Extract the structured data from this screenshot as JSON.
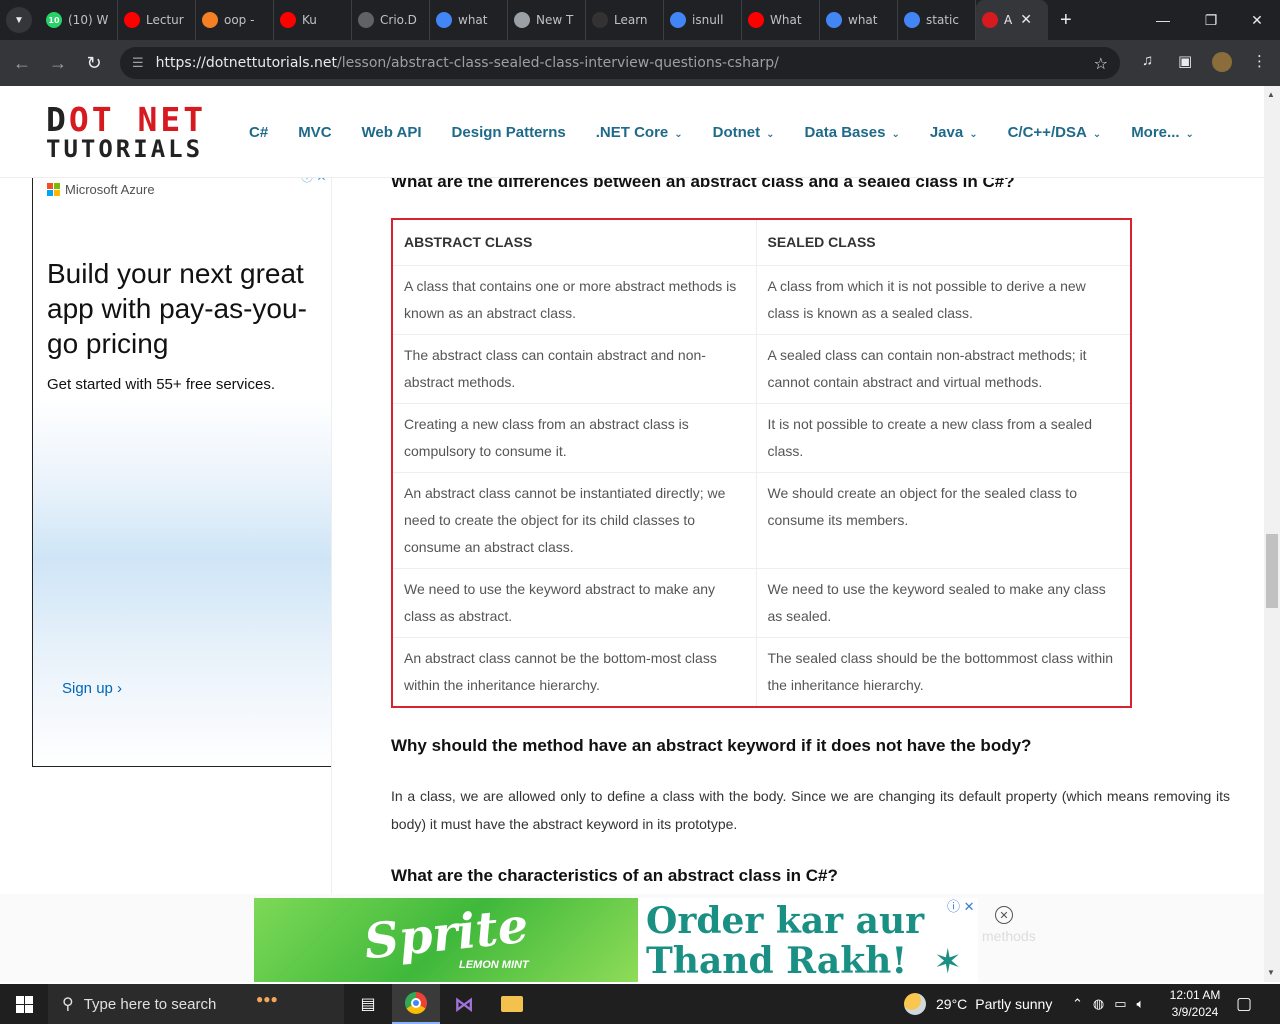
{
  "browser": {
    "tabs": [
      {
        "label": "(10) W",
        "icon": "whatsapp-icon",
        "color": "#25d366",
        "badge": "10"
      },
      {
        "label": "Lectur",
        "icon": "youtube-icon",
        "color": "#ff0000"
      },
      {
        "label": "oop -",
        "icon": "stackoverflow-icon",
        "color": "#f48024"
      },
      {
        "label": "Ku",
        "icon": "youtube-icon",
        "color": "#ff0000"
      },
      {
        "label": "Crio.D",
        "icon": "crio-icon",
        "color": "#5f6368"
      },
      {
        "label": "what",
        "icon": "google-icon",
        "color": "#4285f4"
      },
      {
        "label": "New T",
        "icon": "chrome-icon",
        "color": "#9aa0a6"
      },
      {
        "label": "Learn",
        "icon": "learn-icon",
        "color": "#333333"
      },
      {
        "label": "isnull",
        "icon": "google-icon",
        "color": "#4285f4"
      },
      {
        "label": "What",
        "icon": "youtube-icon",
        "color": "#ff0000"
      },
      {
        "label": "what",
        "icon": "google-icon",
        "color": "#4285f4"
      },
      {
        "label": "static",
        "icon": "google-icon",
        "color": "#4285f4"
      }
    ],
    "active_tab": {
      "label": "A",
      "icon": "dotnet-tutorials-icon",
      "color": "#d71920"
    },
    "url_host": "https://dotnettutorials.net",
    "url_path": "/lesson/abstract-class-sealed-class-interview-questions-csharp/"
  },
  "site": {
    "logo_line1_d": "D",
    "logo_line1_rest": "OT NET",
    "logo_line2": "TUTORIALS",
    "menu": [
      {
        "label": "C#",
        "dropdown": false
      },
      {
        "label": "MVC",
        "dropdown": false
      },
      {
        "label": "Web API",
        "dropdown": false
      },
      {
        "label": "Design Patterns",
        "dropdown": false
      },
      {
        "label": ".NET Core",
        "dropdown": true
      },
      {
        "label": "Dotnet",
        "dropdown": true
      },
      {
        "label": "Data Bases",
        "dropdown": true
      },
      {
        "label": "Java",
        "dropdown": true
      },
      {
        "label": "C/C++/DSA",
        "dropdown": true
      },
      {
        "label": "More...",
        "dropdown": true
      }
    ]
  },
  "side_ad": {
    "brand": "Microsoft Azure",
    "headline": "Build your next great app with pay-as-you-go pricing",
    "subtext": "Get started with 55+ free services.",
    "cta": "Sign up ›",
    "colors": [
      "#f25022",
      "#7fba00",
      "#00a4ef",
      "#ffb900"
    ]
  },
  "article": {
    "heading_top": "What are the differences between an abstract class and a sealed class in C#?",
    "table": {
      "headers": [
        "ABSTRACT CLASS",
        "SEALED CLASS"
      ],
      "rows": [
        [
          "A class that contains one or more abstract methods is known as an abstract class.",
          "A class from which it is not possible to derive a new class is known as a sealed class."
        ],
        [
          "The abstract class can contain abstract and non-abstract methods.",
          "A sealed class can contain non-abstract methods; it cannot contain abstract and virtual methods."
        ],
        [
          "Creating a new class from an abstract class is compulsory to consume it.",
          "It is not possible to create a new class from a sealed class."
        ],
        [
          "An abstract class cannot be instantiated directly; we need to create the object for its child classes to consume an abstract class.",
          "We should create an object for the sealed class to consume its members."
        ],
        [
          "We need to use the keyword abstract to make any class as abstract.",
          "We need to use the keyword sealed to make any class as sealed."
        ],
        [
          "An abstract class cannot be the bottom-most class within the inheritance hierarchy.",
          "The sealed class should be the bottommost class within the inheritance hierarchy."
        ]
      ]
    },
    "heading_2": "Why should the method have an abstract keyword if it does not have the body?",
    "paragraph": "In a class, we are allowed only to define a class with the body. Since we are changing its default property (which means removing its body) it must have the abstract keyword in its prototype.",
    "heading_3": "What are the characteristics of an abstract class in C#?"
  },
  "bottom_ad": {
    "brand": "Sprite",
    "flavor": "LEMON MINT",
    "line1": "Order kar aur",
    "line2": "Thand Rakh!",
    "ghost_text": "methods"
  },
  "taskbar": {
    "search_placeholder": "Type here to search",
    "temperature": "29°C",
    "weather": "Partly sunny",
    "time": "12:01 AM",
    "date": "3/9/2024"
  }
}
